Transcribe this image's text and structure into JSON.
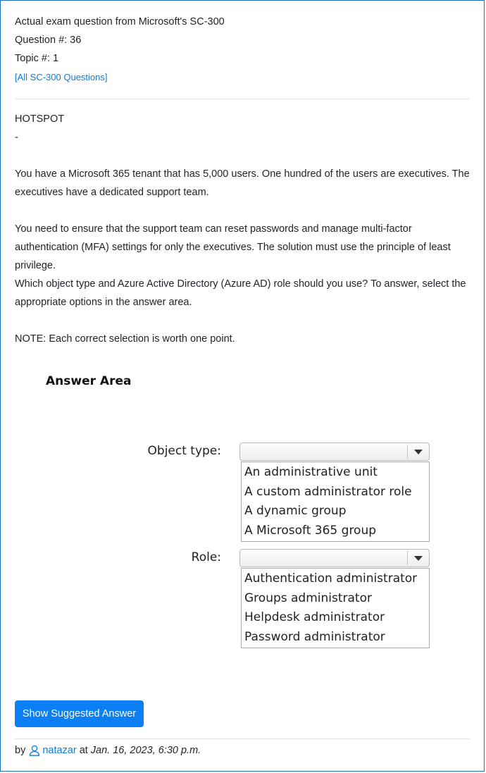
{
  "header": {
    "title": "Actual exam question from Microsoft's SC-300",
    "question_number": "Question #: 36",
    "topic": "Topic #: 1",
    "all_questions_link": "[All SC-300 Questions]"
  },
  "question": {
    "type_label": "HOTSPOT",
    "dash": "-",
    "paragraphs": [
      "You have a Microsoft 365 tenant that has 5,000 users. One hundred of the users are executives. The executives have a dedicated support team.",
      "You need to ensure that the support team can reset passwords and manage multi-factor authentication (MFA) settings for only the executives. The solution must use the principle of least privilege.",
      "Which object type and Azure Active Directory (Azure AD) role should you use? To answer, select the appropriate options in the answer area.",
      "NOTE: Each correct selection is worth one point."
    ]
  },
  "answer_area": {
    "title": "Answer Area",
    "object_type": {
      "label": "Object type:",
      "options": [
        "An administrative unit",
        "A custom administrator role",
        "A dynamic group",
        "A Microsoft 365 group"
      ]
    },
    "role": {
      "label": "Role:",
      "options": [
        "Authentication administrator",
        "Groups administrator",
        "Helpdesk administrator",
        "Password administrator"
      ]
    }
  },
  "actions": {
    "show_answer_label": "Show Suggested Answer"
  },
  "footer": {
    "by": "by",
    "username": "natazar",
    "at": "at",
    "date": "Jan. 16, 2023, 6:30 p.m."
  },
  "colors": {
    "accent": "#0d7ff5",
    "link": "#0d7bd8",
    "border": "#1b6fc0"
  }
}
